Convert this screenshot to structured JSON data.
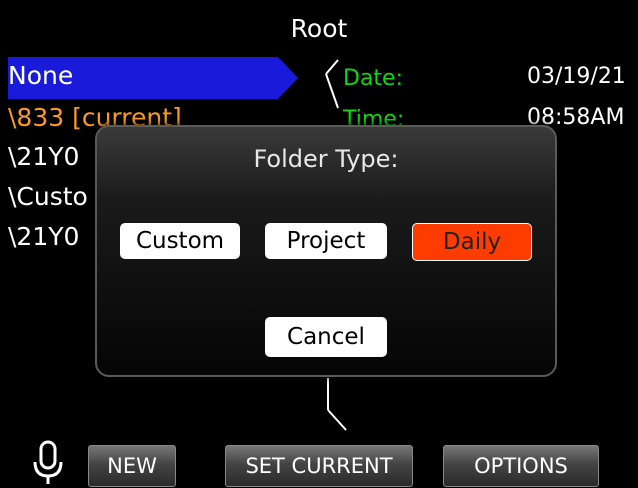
{
  "header": {
    "title": "Root"
  },
  "folders": [
    {
      "label": "None",
      "color": "#ffffff",
      "selected": true
    },
    {
      "label": "\\833 [current]",
      "color": "#ff9a1f"
    },
    {
      "label": "\\21Y0",
      "color": "#ffffff"
    },
    {
      "label": "\\Custo",
      "color": "#ffffff"
    },
    {
      "label": "\\21Y0",
      "color": "#ffffff"
    }
  ],
  "info": {
    "date_label": "Date:",
    "date_value": "03/19/21",
    "time_label": "Time:",
    "time_value": "08:58AM"
  },
  "dialog": {
    "title": "Folder Type:",
    "options": [
      "Custom",
      "Project",
      "Daily"
    ],
    "selected": "Daily",
    "cancel_label": "Cancel"
  },
  "softkeys": {
    "mic_icon": "microphone-icon",
    "new_label": "NEW",
    "set_current_label": "SET CURRENT",
    "options_label": "OPTIONS"
  },
  "colors": {
    "selection": "#1a1adb",
    "accent_red": "#ff3c00",
    "info_label": "#0fd80f",
    "current_folder": "#ff9a1f"
  }
}
